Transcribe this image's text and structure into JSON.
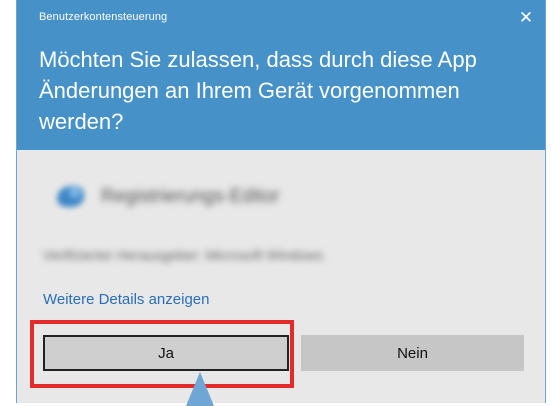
{
  "dialog": {
    "caption": "Benutzerkontensteuerung",
    "close_glyph": "✕",
    "question": "Möchten Sie zulassen, dass durch diese App Änderungen an Ihrem Gerät vorgenommen werden?",
    "app_name": "Registrierungs-Editor",
    "publisher": "Verifizierter Herausgeber: Microsoft Windows",
    "details_link": "Weitere Details anzeigen",
    "yes_label": "Ja",
    "no_label": "Nein"
  },
  "colors": {
    "header": "#4591c8",
    "body": "#e8e8e8",
    "highlight": "#e42b2b",
    "arrow": "#6fa6d6",
    "link": "#2a6eb5"
  },
  "icons": {
    "app_icon": "registry-editor-icon",
    "close_icon": "close-icon",
    "pointer": "arrow-up-pointer"
  }
}
